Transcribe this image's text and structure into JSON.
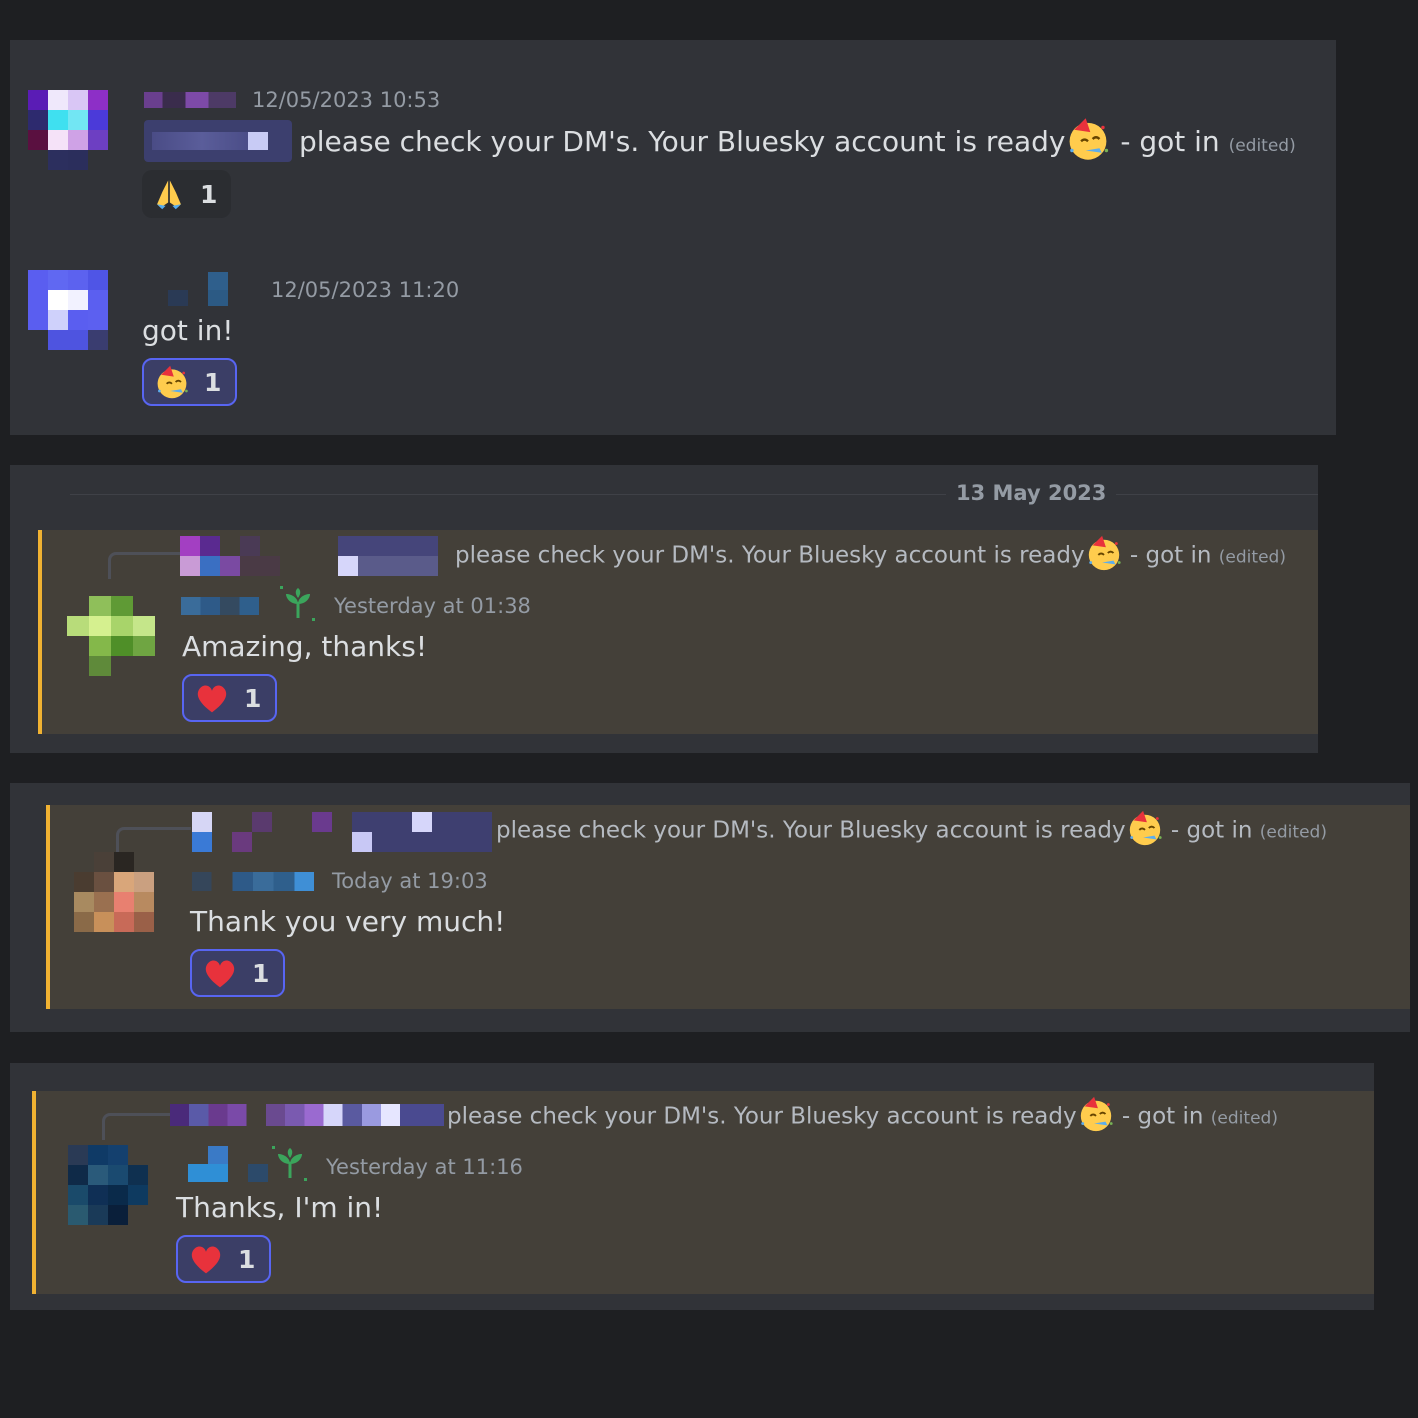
{
  "colors": {
    "background": "#1e1f22",
    "panel": "#313338",
    "highlight": "#444039",
    "highlight_bar": "#f0b232",
    "accent": "#5865f2",
    "timestamp": "#949ba4",
    "heart": "#e8323c"
  },
  "messages": [
    {
      "timestamp": "12/05/2023 10:53",
      "text": "please check your DM's. Your Bluesky account is ready",
      "suffix": " - got in",
      "edited": "(edited)",
      "reaction": {
        "emoji": "folded-hands-icon",
        "count": "1"
      }
    },
    {
      "timestamp": "12/05/2023 11:20",
      "text": "got in!",
      "reaction": {
        "emoji": "party-face-icon",
        "count": "1"
      }
    }
  ],
  "date_divider": "13 May 2023",
  "replies": [
    {
      "quoted_text": "please check your DM's. Your Bluesky account is ready",
      "quoted_suffix": " - got in",
      "edited": "(edited)",
      "timestamp": "Yesterday at 01:38",
      "text": "Amazing, thanks!",
      "reaction": {
        "emoji": "heart-icon",
        "count": "1"
      }
    },
    {
      "quoted_text": "please check your DM's. Your Bluesky account is ready",
      "quoted_suffix": " - got in",
      "edited": "(edited)",
      "timestamp": "Today at 19:03",
      "text": "Thank you very much!",
      "reaction": {
        "emoji": "heart-icon",
        "count": "1"
      }
    },
    {
      "quoted_text": "please check your DM's. Your Bluesky account is ready",
      "quoted_suffix": " - got in",
      "edited": "(edited)",
      "timestamp": "Yesterday at 11:16",
      "text": "Thanks, I'm in!",
      "reaction": {
        "emoji": "heart-icon",
        "count": "1"
      }
    }
  ]
}
